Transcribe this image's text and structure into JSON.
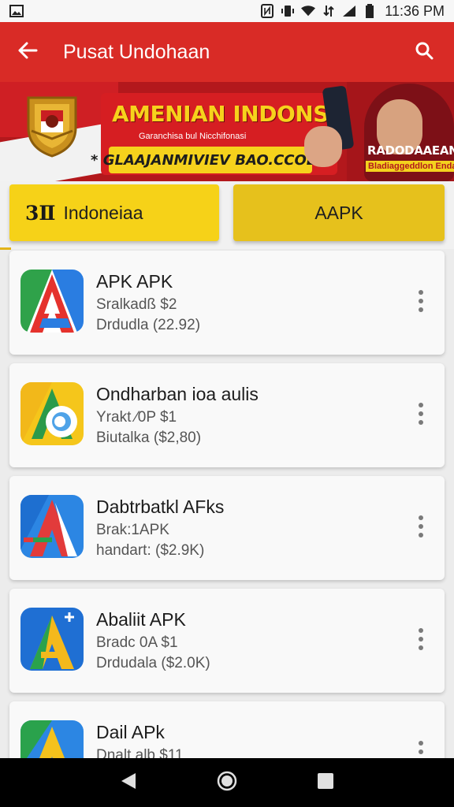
{
  "status_bar": {
    "time": "11:36 PM",
    "icons": [
      "image-icon",
      "nfc-icon",
      "vibrate-icon",
      "wifi-icon",
      "data-icon",
      "signal-icon",
      "battery-icon"
    ]
  },
  "app_bar": {
    "title": "Pusat Undohaan",
    "back_icon": "arrow-left-icon",
    "search_icon": "search-icon",
    "color": "#d92b26"
  },
  "banner": {
    "headline": "AMENIAN INDONSAIA",
    "small_text": "Garanchisa bul Nicchifonasi",
    "pill_text": "* GLAAJANMIVIEV BAO.CCOB!)",
    "side_title": "RADODAAEAN",
    "side_badge": "Bladiaggeddlon Endaeaa"
  },
  "filters": [
    {
      "glyph": "3Ⅱ",
      "label": "Indoneiaa",
      "color": "#f6d218"
    },
    {
      "glyph": "",
      "label": "AAPK",
      "color": "#e6c11c"
    }
  ],
  "apps": [
    {
      "name": "APK APK",
      "line2": "Sralkadß $2",
      "line3": "Drdudla (22.92)",
      "icon": "apk-a-red-icon"
    },
    {
      "name": "Ondharban ioa aulis",
      "line2": "Yrakt ⁄0P $1",
      "line3": "Biutalka ($2,80)",
      "icon": "apk-a-yellow-icon"
    },
    {
      "name": "Dabtrbatkl AFks",
      "line2": "Brak:1APK",
      "line3": "handart: ($2.9K)",
      "icon": "apk-a-blue-icon"
    },
    {
      "name": "Abaliit APK",
      "line2": "Bradc 0A $1",
      "line3": "Drdudala ($2.0K)",
      "icon": "apk-a-plus-icon"
    },
    {
      "name": "Dail APk",
      "line2": "Dnalt alb $11",
      "line3": "",
      "icon": "apk-a-green-icon"
    }
  ],
  "nav": {
    "back": "back-icon",
    "home": "home-icon",
    "recents": "recents-icon"
  }
}
